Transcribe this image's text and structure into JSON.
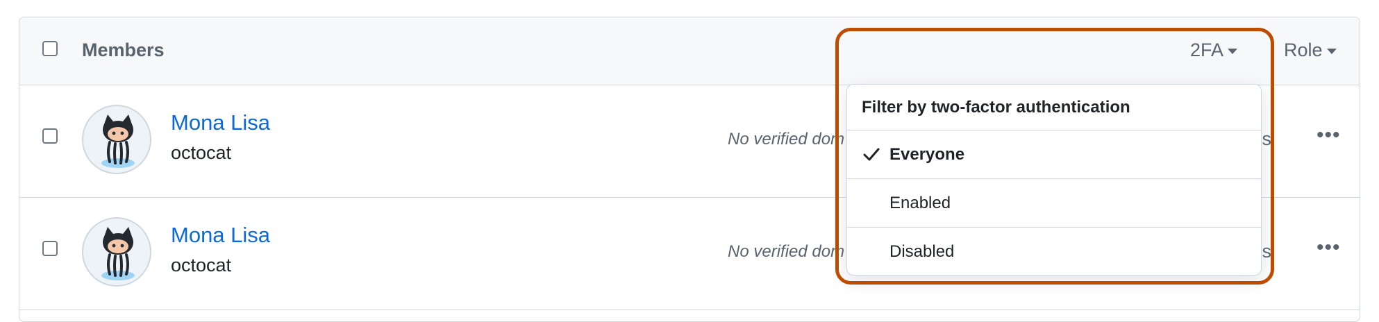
{
  "header": {
    "title": "Members",
    "twofa_label": "2FA",
    "role_label": "Role"
  },
  "members": [
    {
      "name": "Mona Lisa",
      "login": "octocat",
      "domain_note": "No verified dom",
      "teams_suffix": "ams"
    },
    {
      "name": "Mona Lisa",
      "login": "octocat",
      "domain_note": "No verified dom",
      "teams_suffix": "ams"
    }
  ],
  "filter_menu": {
    "title": "Filter by two-factor authentication",
    "options": [
      {
        "label": "Everyone",
        "selected": true
      },
      {
        "label": "Enabled",
        "selected": false
      },
      {
        "label": "Disabled",
        "selected": false
      }
    ]
  },
  "icons": {
    "avatar": "octocat-avatar",
    "more": "kebab-horizontal-icon",
    "check": "check-icon",
    "caret": "triangle-down-icon"
  },
  "colors": {
    "link": "#0969da",
    "muted": "#59636e",
    "border": "#d0d7de",
    "highlight": "#bc4c00",
    "header_bg": "#f6f8fa"
  }
}
